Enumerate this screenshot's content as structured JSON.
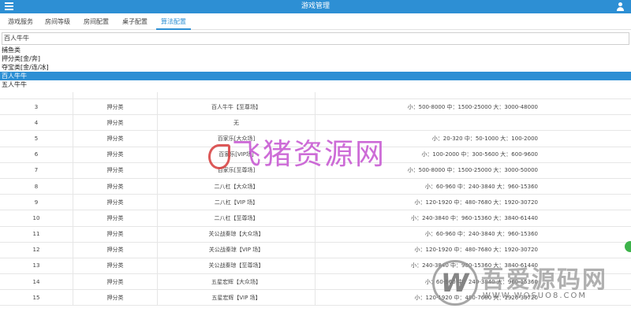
{
  "app": {
    "title": "游戏管理",
    "menu_icon": "menu-icon",
    "user_icon": "user-icon"
  },
  "tabs": [
    {
      "label": "游戏服务",
      "active": false
    },
    {
      "label": "房间等级",
      "active": false
    },
    {
      "label": "房间配置",
      "active": false
    },
    {
      "label": "桌子配置",
      "active": false
    },
    {
      "label": "算法配置",
      "active": true
    }
  ],
  "select": {
    "value": "百人牛牛",
    "options": [
      "捕鱼类",
      "押分类[金/奔]",
      "夺宝类[金/连/冰]",
      "百人牛牛",
      "五人牛牛"
    ],
    "selected_index": 3
  },
  "table": {
    "rows": [
      {
        "id": "",
        "type": "",
        "room": "",
        "range": ""
      },
      {
        "id": "3",
        "type": "押分类",
        "room": "百人牛牛【至尊场】",
        "range": "小：500-8000 中：1500-25000 大：3000-48000"
      },
      {
        "id": "4",
        "type": "押分类",
        "room": "无",
        "range": ""
      },
      {
        "id": "5",
        "type": "押分类",
        "room": "百家乐[大众场]",
        "range": "小：20-320 中：50-1000 大：100-2000"
      },
      {
        "id": "6",
        "type": "押分类",
        "room": "百家乐[VIP场]",
        "range": "小：100-2000 中：300-5600 大：600-9600"
      },
      {
        "id": "7",
        "type": "押分类",
        "room": "百家乐[至尊场]",
        "range": "小：500-8000 中：1500-25000 大：3000-50000"
      },
      {
        "id": "8",
        "type": "押分类",
        "room": "二八杠【大众场】",
        "range": "小：60-960 中：240-3840 大：960-15360"
      },
      {
        "id": "9",
        "type": "押分类",
        "room": "二八杠【VIP 场】",
        "range": "小：120-1920 中：480-7680 大：1920-30720"
      },
      {
        "id": "10",
        "type": "押分类",
        "room": "二八杠【至尊场】",
        "range": "小：240-3840 中：960-15360 大：3840-61440"
      },
      {
        "id": "11",
        "type": "押分类",
        "room": "关公战秦琼【大众场】",
        "range": "小：60-960 中：240-3840 大：960-15360"
      },
      {
        "id": "12",
        "type": "押分类",
        "room": "关公战秦琼【VIP 场】",
        "range": "小：120-1920 中：480-7680 大：1920-30720"
      },
      {
        "id": "13",
        "type": "押分类",
        "room": "关公战秦琼【至尊场】",
        "range": "小：240-3840 中：960-15360 大：3840-61440"
      },
      {
        "id": "14",
        "type": "押分类",
        "room": "五星宏辉【大众场】",
        "range": "小：60-960 中：240-3840 大：960-15360"
      },
      {
        "id": "15",
        "type": "押分类",
        "room": "五星宏辉【VIP 场】",
        "range": "小：120-1920 中：480-7680 大：1920-30720"
      }
    ]
  },
  "watermarks": {
    "center": "飞猪资源网",
    "corner_title": "吾爱源码网",
    "corner_url": "WWW.WOSUO8.COM"
  },
  "colors": {
    "accent": "#2d8fd4",
    "side_button": "#3db34a"
  }
}
